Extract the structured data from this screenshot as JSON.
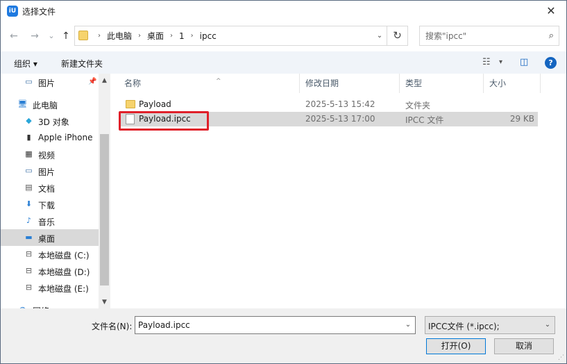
{
  "window": {
    "title": "选择文件",
    "app_icon_text": "iU",
    "close_glyph": "✕"
  },
  "nav": {
    "back_glyph": "←",
    "forward_glyph": "→",
    "recent_glyph": "⌄",
    "up_glyph": "↑"
  },
  "address": {
    "crumbs": [
      "此电脑",
      "桌面",
      "1",
      "ipcc"
    ],
    "separator": "›",
    "dropdown_glyph": "⌄",
    "refresh_glyph": "↻"
  },
  "search": {
    "placeholder": "搜索\"ipcc\"",
    "icon_glyph": "⌕"
  },
  "toolbar": {
    "organize_label": "组织 ▾",
    "new_folder_label": "新建文件夹",
    "view_glyph": "☷",
    "view_dd_glyph": "▾",
    "preview_glyph": "◫",
    "help_glyph": "?"
  },
  "sidebar": {
    "items": [
      {
        "label": "图片",
        "icon": "pictures-icon",
        "glyph": "▭",
        "color": "#3a6ea5",
        "pinned": true
      },
      {
        "label": "此电脑",
        "icon": "this-pc-icon",
        "glyph": "🖥",
        "color": "#2a7fd4"
      },
      {
        "label": "3D 对象",
        "icon": "3d-objects-icon",
        "glyph": "◆",
        "color": "#2aa6d9"
      },
      {
        "label": "Apple iPhone",
        "icon": "iphone-icon",
        "glyph": "▮",
        "color": "#333333"
      },
      {
        "label": "视频",
        "icon": "videos-icon",
        "glyph": "▦",
        "color": "#333333"
      },
      {
        "label": "图片",
        "icon": "pictures-icon",
        "glyph": "▭",
        "color": "#3a6ea5"
      },
      {
        "label": "文档",
        "icon": "documents-icon",
        "glyph": "▤",
        "color": "#555555"
      },
      {
        "label": "下载",
        "icon": "downloads-icon",
        "glyph": "⬇",
        "color": "#2a7fd4"
      },
      {
        "label": "音乐",
        "icon": "music-icon",
        "glyph": "♪",
        "color": "#2a7fd4"
      },
      {
        "label": "桌面",
        "icon": "desktop-icon",
        "glyph": "▬",
        "color": "#2a7fd4",
        "selected": true
      },
      {
        "label": "本地磁盘 (C:)",
        "icon": "drive-c-icon",
        "glyph": "⊟",
        "color": "#555555"
      },
      {
        "label": "本地磁盘 (D:)",
        "icon": "drive-d-icon",
        "glyph": "⊟",
        "color": "#555555"
      },
      {
        "label": "本地磁盘 (E:)",
        "icon": "drive-e-icon",
        "glyph": "⊟",
        "color": "#555555"
      },
      {
        "label": "网络",
        "icon": "network-icon",
        "glyph": "◍",
        "color": "#2a7fd4"
      }
    ],
    "pin_glyph": "📌",
    "scroll_up_glyph": "▲",
    "scroll_down_glyph": "▼"
  },
  "filelist": {
    "columns": [
      "名称",
      "修改日期",
      "类型",
      "大小"
    ],
    "sort_glyph": "^",
    "rows": [
      {
        "name": "Payload",
        "date": "2025-5-13 15:42",
        "type": "文件夹",
        "size": "",
        "icon": "folder-icon"
      },
      {
        "name": "Payload.ipcc",
        "date": "2025-5-13 17:00",
        "type": "IPCC 文件",
        "size": "29 KB",
        "icon": "file-icon",
        "selected": true
      }
    ]
  },
  "bottom": {
    "filename_label": "文件名(N):",
    "filename_value": "Payload.ipcc",
    "filter_value": "IPCC文件 (*.ipcc);",
    "open_label": "打开(O)",
    "cancel_label": "取消",
    "dropdown_glyph": "⌄",
    "grip_glyph": "⋰"
  }
}
